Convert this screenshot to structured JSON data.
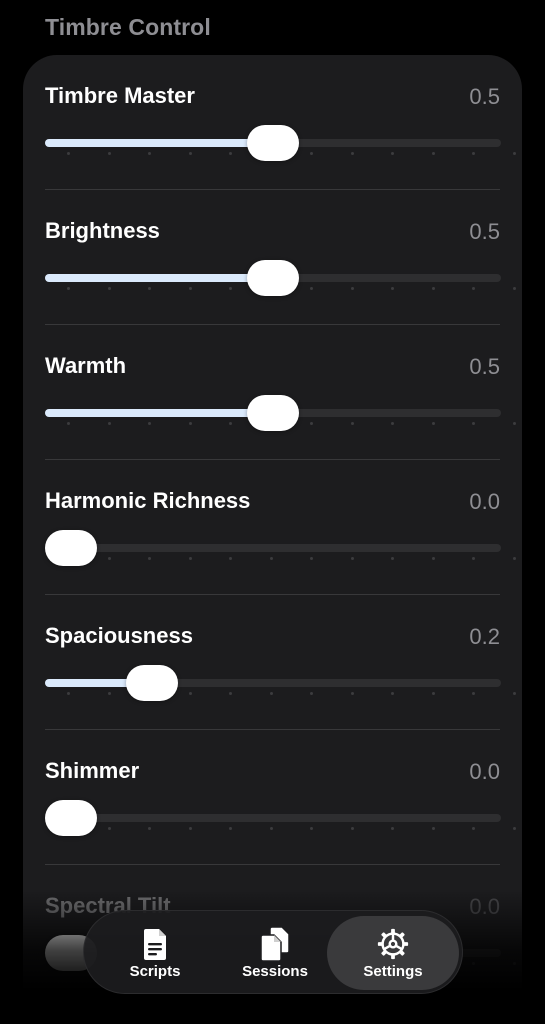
{
  "header": {
    "title": "Timbre Control"
  },
  "sliders": [
    {
      "label": "Timbre Master",
      "value": "0.5",
      "level": 0.5
    },
    {
      "label": "Brightness",
      "value": "0.5",
      "level": 0.5
    },
    {
      "label": "Warmth",
      "value": "0.5",
      "level": 0.5
    },
    {
      "label": "Harmonic Richness",
      "value": "0.0",
      "level": 0.0
    },
    {
      "label": "Spaciousness",
      "value": "0.2",
      "level": 0.2
    },
    {
      "label": "Shimmer",
      "value": "0.0",
      "level": 0.0
    },
    {
      "label": "Spectral Tilt",
      "value": "0.0",
      "level": 0.0
    }
  ],
  "tabbar": {
    "tabs": [
      {
        "label": "Scripts",
        "icon": "document-icon",
        "active": false
      },
      {
        "label": "Sessions",
        "icon": "documents-icon",
        "active": false
      },
      {
        "label": "Settings",
        "icon": "gear-icon",
        "active": true
      }
    ]
  },
  "colors": {
    "background": "#000000",
    "card": "#1c1c1e",
    "slider_fill": "#dbeafc",
    "secondary_text": "#8e8e93"
  }
}
